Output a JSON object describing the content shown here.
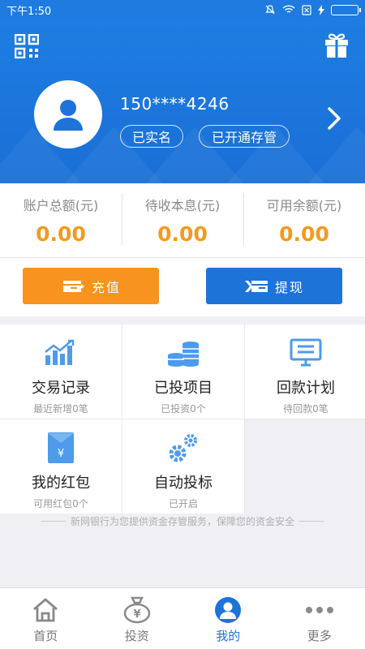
{
  "status_bar": {
    "time": "下午1:50"
  },
  "header": {
    "phone": "150****4246",
    "tags": [
      "已实名",
      "已开通存管"
    ]
  },
  "balances": [
    {
      "label": "账户总额(元)",
      "value": "0.00"
    },
    {
      "label": "待收本息(元)",
      "value": "0.00"
    },
    {
      "label": "可用余额(元)",
      "value": "0.00"
    }
  ],
  "actions": {
    "recharge_label": "充值",
    "withdraw_label": "提现"
  },
  "grid": [
    {
      "title": "交易记录",
      "sub": "最近新增0笔",
      "icon": "chart-icon"
    },
    {
      "title": "已投项目",
      "sub": "已投资0个",
      "icon": "coins-icon"
    },
    {
      "title": "回款计划",
      "sub": "待回款0笔",
      "icon": "monitor-icon"
    },
    {
      "title": "我的红包",
      "sub": "可用红包0个",
      "icon": "red-envelope-icon"
    },
    {
      "title": "自动投标",
      "sub": "已开启",
      "icon": "gears-icon"
    }
  ],
  "notice": "新网银行为您提供资金存管服务，保障您的资金安全",
  "tabs": [
    {
      "label": "首页",
      "icon": "home-icon"
    },
    {
      "label": "投资",
      "icon": "money-bag-icon"
    },
    {
      "label": "我的",
      "icon": "user-icon"
    },
    {
      "label": "更多",
      "icon": "more-icon"
    }
  ],
  "colors": {
    "primary": "#1e73d9",
    "accent": "#f7931e",
    "amount": "#f39a1e"
  },
  "battery_level": 1.0
}
